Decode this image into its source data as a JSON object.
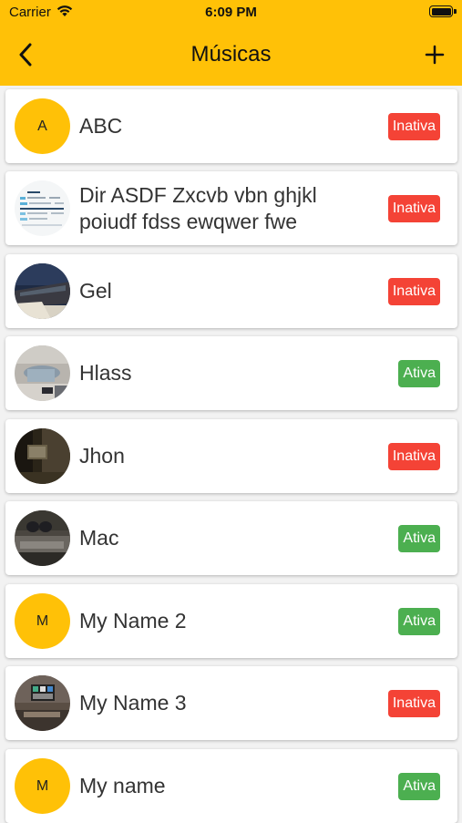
{
  "status_bar": {
    "carrier": "Carrier",
    "time": "6:09 PM"
  },
  "nav": {
    "title": "Músicas",
    "back_icon": "chevron-left-icon",
    "add_icon": "plus-icon"
  },
  "colors": {
    "header": "#FFC107",
    "inactive": "#F44336",
    "active": "#4CAF50",
    "avatar_letter_bg": "#FFC107"
  },
  "items": [
    {
      "name": "ABC",
      "avatar_letter": "A",
      "status": "Inativa"
    },
    {
      "name": "Dir ASDF Zxcvb vbn ghjkl poiudf fdss ewqwer fwe",
      "status": "Inativa"
    },
    {
      "name": "Gel",
      "status": "Inativa"
    },
    {
      "name": "Hlass",
      "status": "Ativa"
    },
    {
      "name": "Jhon",
      "status": "Inativa"
    },
    {
      "name": "Mac",
      "status": "Ativa"
    },
    {
      "name": "My Name 2",
      "avatar_letter": "M",
      "status": "Ativa"
    },
    {
      "name": "My Name 3",
      "status": "Inativa"
    },
    {
      "name": "My name",
      "avatar_letter": "M",
      "status": "Ativa"
    }
  ]
}
